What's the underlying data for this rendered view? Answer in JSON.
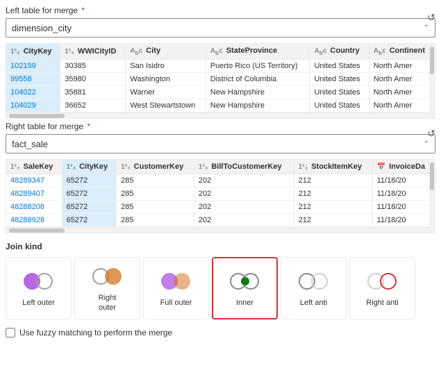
{
  "left_table": {
    "label": "Left table for merge",
    "required": true,
    "selected_value": "dimension_city",
    "columns": [
      {
        "icon": "123",
        "name": "CityKey",
        "highlighted": true
      },
      {
        "icon": "123",
        "name": "WWICityID"
      },
      {
        "icon": "abc",
        "name": "City"
      },
      {
        "icon": "abc",
        "name": "StateProvince"
      },
      {
        "icon": "abc",
        "name": "Country"
      },
      {
        "icon": "abc",
        "name": "Continent"
      }
    ],
    "rows": [
      [
        "102159",
        "30385",
        "San Isidro",
        "Puerto Rico (US Territory)",
        "United States",
        "North Amer"
      ],
      [
        "99558",
        "35980",
        "Washington",
        "District of Columbia",
        "United States",
        "North Amer"
      ],
      [
        "104022",
        "35881",
        "Warner",
        "New Hampshire",
        "United States",
        "North Amer"
      ],
      [
        "104029",
        "36652",
        "West Stewartstown",
        "New Hampshire",
        "United States",
        "North Amer"
      ]
    ]
  },
  "right_table": {
    "label": "Right table for merge",
    "required": true,
    "selected_value": "fact_sale",
    "columns": [
      {
        "icon": "123",
        "name": "SaleKey"
      },
      {
        "icon": "123",
        "name": "CityKey",
        "highlighted": true
      },
      {
        "icon": "123",
        "name": "CustomerKey"
      },
      {
        "icon": "123",
        "name": "BillToCustomerKey"
      },
      {
        "icon": "123",
        "name": "StockItemKey"
      },
      {
        "icon": "cal",
        "name": "InvoiceDa"
      }
    ],
    "rows": [
      [
        "48289347",
        "65272",
        "285",
        "202",
        "212",
        "11/18/20"
      ],
      [
        "48289407",
        "65272",
        "285",
        "202",
        "212",
        "11/18/20"
      ],
      [
        "48288208",
        "65272",
        "285",
        "202",
        "212",
        "11/18/20"
      ],
      [
        "48288928",
        "65272",
        "285",
        "202",
        "212",
        "11/18/20"
      ]
    ]
  },
  "join_kind": {
    "label": "Join kind",
    "options": [
      {
        "id": "left-outer",
        "label": "Left outer",
        "active": false
      },
      {
        "id": "right-outer",
        "label": "Right outer",
        "active": false
      },
      {
        "id": "full-outer",
        "label": "Full outer",
        "active": false
      },
      {
        "id": "inner",
        "label": "Inner",
        "active": true
      },
      {
        "id": "left-anti",
        "label": "Left anti",
        "active": false
      },
      {
        "id": "right-anti",
        "label": "Right anti",
        "active": false
      }
    ]
  },
  "fuzzy_checkbox": {
    "label": "Use fuzzy matching to perform the merge",
    "checked": false
  }
}
